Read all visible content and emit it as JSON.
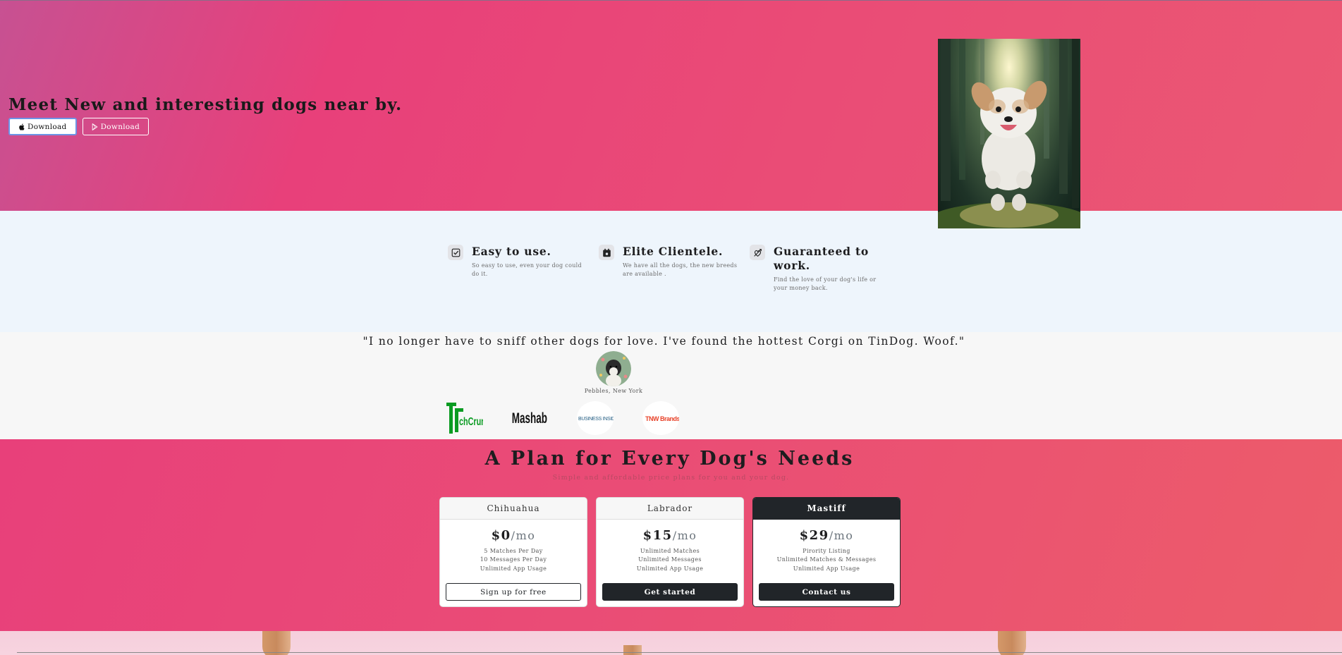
{
  "hero": {
    "title": "Meet New and interesting dogs near by.",
    "apple_button_label": "Download",
    "play_button_label": "Download",
    "photo_alt": "dog jumping in forest"
  },
  "features": [
    {
      "icon": "checkbox-icon",
      "title": "Easy to use.",
      "text": "So easy to use, even your dog could do it."
    },
    {
      "icon": "calendar-lock-icon",
      "title": "Elite Clientele.",
      "text": "We have all the dogs, the new breeds are available ."
    },
    {
      "icon": "heart-arrow-icon",
      "title": "Guaranteed to work.",
      "text": "Find the love of your dog's life or your money back."
    }
  ],
  "testimonial": {
    "quote": "\"I no longer have to sniff other dogs for love. I've found the hottest Corgi on TinDog. Woof.\"",
    "author": "Pebbles, New York"
  },
  "press": [
    "TechCrunch",
    "Mashable",
    "BusinessInsider",
    "TNW Brands"
  ],
  "pricing": {
    "title": "A Plan for Every Dog's Needs",
    "subtitle": "Simple and affordable price plans for you and your dog.",
    "plans": [
      {
        "name": "Chihuahua",
        "price": "$0",
        "per": "/mo",
        "features": [
          "5 Matches Per Day",
          "10 Messages Per Day",
          "Unlimited App Usage"
        ],
        "button": "Sign up for free"
      },
      {
        "name": "Labrador",
        "price": "$15",
        "per": "/mo",
        "features": [
          "Unlimited Matches",
          "Unlimited Messages",
          "Unlimited App Usage"
        ],
        "button": "Get started"
      },
      {
        "name": "Mastiff",
        "price": "$29",
        "per": "/mo",
        "features": [
          "Pirority Listing",
          "Unlimited Matches & Messages",
          "Unlimited App Usage"
        ],
        "button": "Contact us"
      }
    ]
  },
  "colors": {
    "hero_pink": "#e8407a",
    "feature_bg": "#eef5fc",
    "testimonial_bg": "#f7f7f7",
    "dark": "#212529"
  }
}
